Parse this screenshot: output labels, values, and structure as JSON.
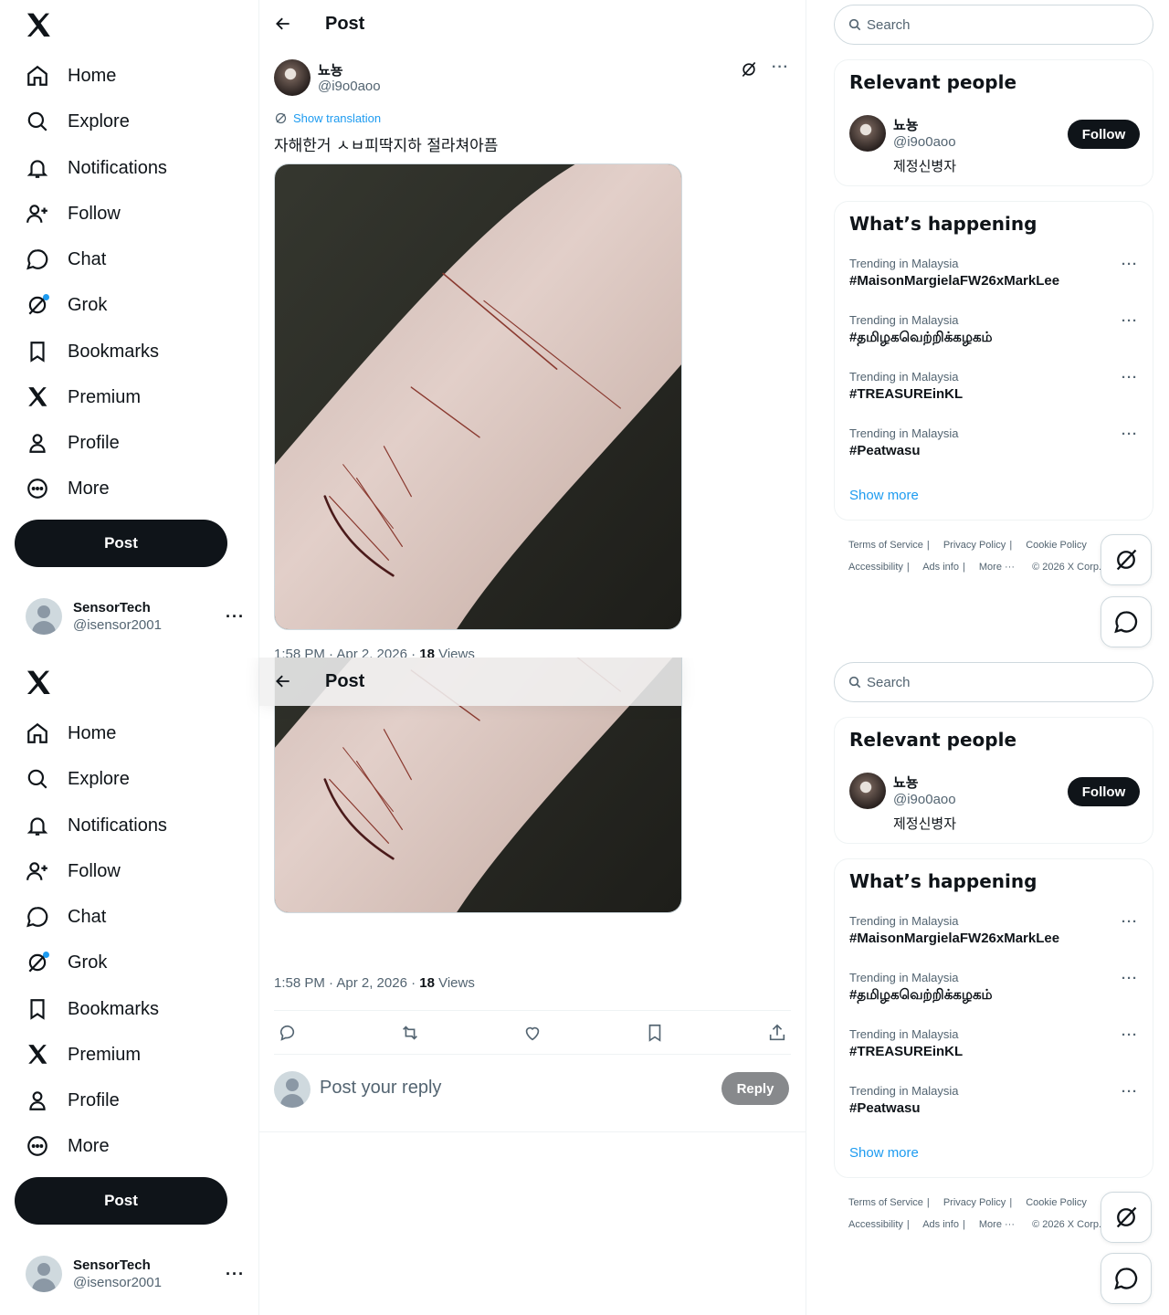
{
  "nav": {
    "items": [
      {
        "label": "Home",
        "icon": "home-icon"
      },
      {
        "label": "Explore",
        "icon": "search-icon"
      },
      {
        "label": "Notifications",
        "icon": "bell-icon"
      },
      {
        "label": "Follow",
        "icon": "person-add-icon"
      },
      {
        "label": "Chat",
        "icon": "chat-bubble-icon"
      },
      {
        "label": "Grok",
        "icon": "grok-icon"
      },
      {
        "label": "Bookmarks",
        "icon": "bookmark-icon"
      },
      {
        "label": "Premium",
        "icon": "x-logo-icon"
      },
      {
        "label": "Profile",
        "icon": "person-icon"
      },
      {
        "label": "More",
        "icon": "more-circle-icon"
      }
    ],
    "post_label": "Post"
  },
  "account": {
    "name": "SensorTech",
    "handle": "@isensor2001",
    "more": "···"
  },
  "main": {
    "header_title": "Post",
    "author_name": "뇨뇽",
    "author_handle": "@i9o0aoo",
    "more": "···",
    "translation_label": "Show translation",
    "text": "자해한거 ㅅㅂ피딱지하 절라쳐아픔",
    "meta_time": "1:58 PM · Apr 2, 2026 · ",
    "meta_views_count": "18",
    "meta_views_label": " Views",
    "reply_placeholder": "Post your reply",
    "reply_label": "Reply"
  },
  "right": {
    "search_placeholder": "Search",
    "relevant_title": "Relevant people",
    "person": {
      "name": "뇨뇽",
      "handle": "@i9o0aoo",
      "bio": "제정신병자",
      "follow_label": "Follow"
    },
    "happening_title": "What’s happening",
    "trends": [
      {
        "context": "Trending in Malaysia",
        "tag": "#MaisonMargielaFW26xMarkLee"
      },
      {
        "context": "Trending in Malaysia",
        "tag": "#தமிழகவெற்றிக்கழகம்"
      },
      {
        "context": "Trending in Malaysia",
        "tag": "#TREASUREinKL"
      },
      {
        "context": "Trending in Malaysia",
        "tag": "#Peatwasu"
      }
    ],
    "trend_more": "···",
    "show_more": "Show more",
    "footer": {
      "terms": "Terms of Service",
      "privacy": "Privacy Policy",
      "cookie": "Cookie Policy",
      "accessibility": "Accessibility",
      "ads": "Ads info",
      "more": "More ···",
      "copyright": "© 2026 X Corp."
    }
  },
  "colors": {
    "accent": "#1d9bf0",
    "text_primary": "#0f1419",
    "text_secondary": "#536471",
    "button_dark": "#0f1419",
    "reply_disabled": "#87898c"
  }
}
